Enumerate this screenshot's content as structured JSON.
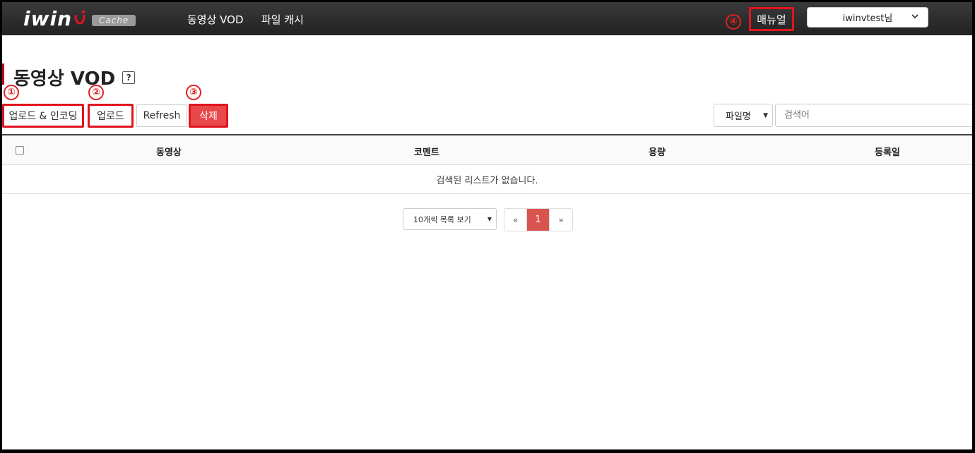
{
  "navbar": {
    "logo_text": "iwin",
    "logo_badge": "Cache",
    "links": [
      "동영상 VOD",
      "파일 캐시"
    ],
    "manual_label": "매뉴얼",
    "user_label": "iwinvtest님"
  },
  "annotations": [
    "①",
    "②",
    "③",
    "④"
  ],
  "page": {
    "title": "동영상 VOD",
    "help": "?"
  },
  "toolbar": {
    "upload_encode": "업로드 & 인코딩",
    "upload": "업로드",
    "refresh": "Refresh",
    "delete": "삭제",
    "search_type": "파일명",
    "search_placeholder": "검색어"
  },
  "table": {
    "columns": [
      "동영상",
      "코멘트",
      "용량",
      "등록일"
    ],
    "empty_message": "검색된 리스트가 없습니다."
  },
  "pagination": {
    "page_size": "10개씩 목록 보기",
    "prev": "«",
    "current": "1",
    "next": "»"
  },
  "colors": {
    "navbar": "#2a2a2a",
    "annotation_red": "#e0141e",
    "delete_button": "#e8484a",
    "active_page": "#d9534f"
  }
}
